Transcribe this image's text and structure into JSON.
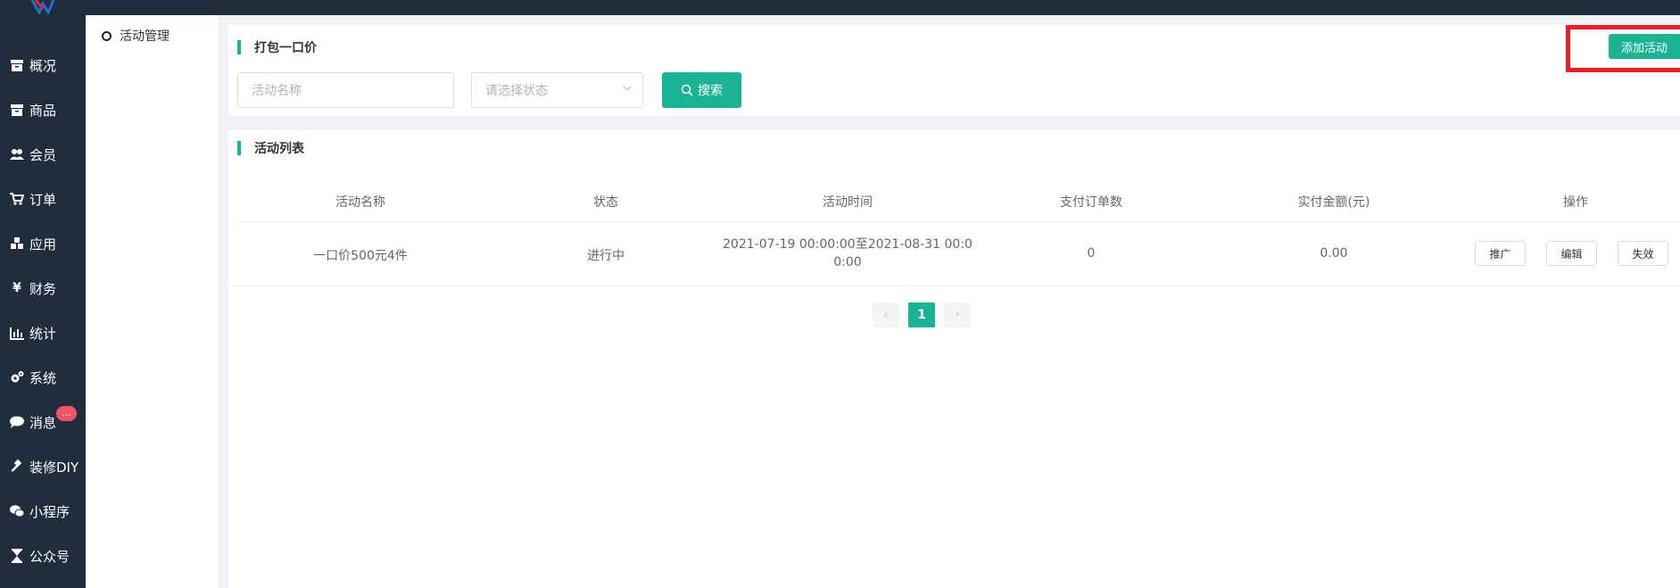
{
  "sidebar": {
    "items": [
      {
        "label": "概况",
        "icon": "archive-icon"
      },
      {
        "label": "商品",
        "icon": "archive-icon"
      },
      {
        "label": "会员",
        "icon": "users-icon"
      },
      {
        "label": "订单",
        "icon": "cart-icon"
      },
      {
        "label": "应用",
        "icon": "cubes-icon"
      },
      {
        "label": "财务",
        "icon": "yen-icon"
      },
      {
        "label": "统计",
        "icon": "bar-chart-icon"
      },
      {
        "label": "系统",
        "icon": "gears-icon"
      },
      {
        "label": "消息",
        "icon": "comment-icon",
        "badge": "..."
      },
      {
        "label": "装修DIY",
        "icon": "gavel-icon"
      },
      {
        "label": "小程序",
        "icon": "wechat-icon"
      },
      {
        "label": "公众号",
        "icon": "hourglass-icon"
      }
    ]
  },
  "subnav": {
    "item": "活动管理"
  },
  "filter_panel": {
    "title": "打包一口价",
    "name_placeholder": "活动名称",
    "status_placeholder": "请选择状态",
    "search_label": "搜索",
    "add_label": "添加活动"
  },
  "list_panel": {
    "title": "活动列表",
    "columns": [
      "活动名称",
      "状态",
      "活动时间",
      "支付订单数",
      "实付金额(元)",
      "操作"
    ],
    "rows": [
      {
        "name": "一口价500元4件",
        "status": "进行中",
        "time_line1": "2021-07-19 00:00:00至2021-08-31 00:0",
        "time_line2": "0:00",
        "orders": "0",
        "amount": "0.00",
        "actions": [
          "推广",
          "编辑",
          "失效"
        ]
      }
    ]
  },
  "pagination": {
    "prev": "‹",
    "current": "1",
    "next": "›"
  },
  "colors": {
    "accent": "#1ab394",
    "sidebar": "#1f2d3d",
    "highlight": "#e8202a"
  }
}
